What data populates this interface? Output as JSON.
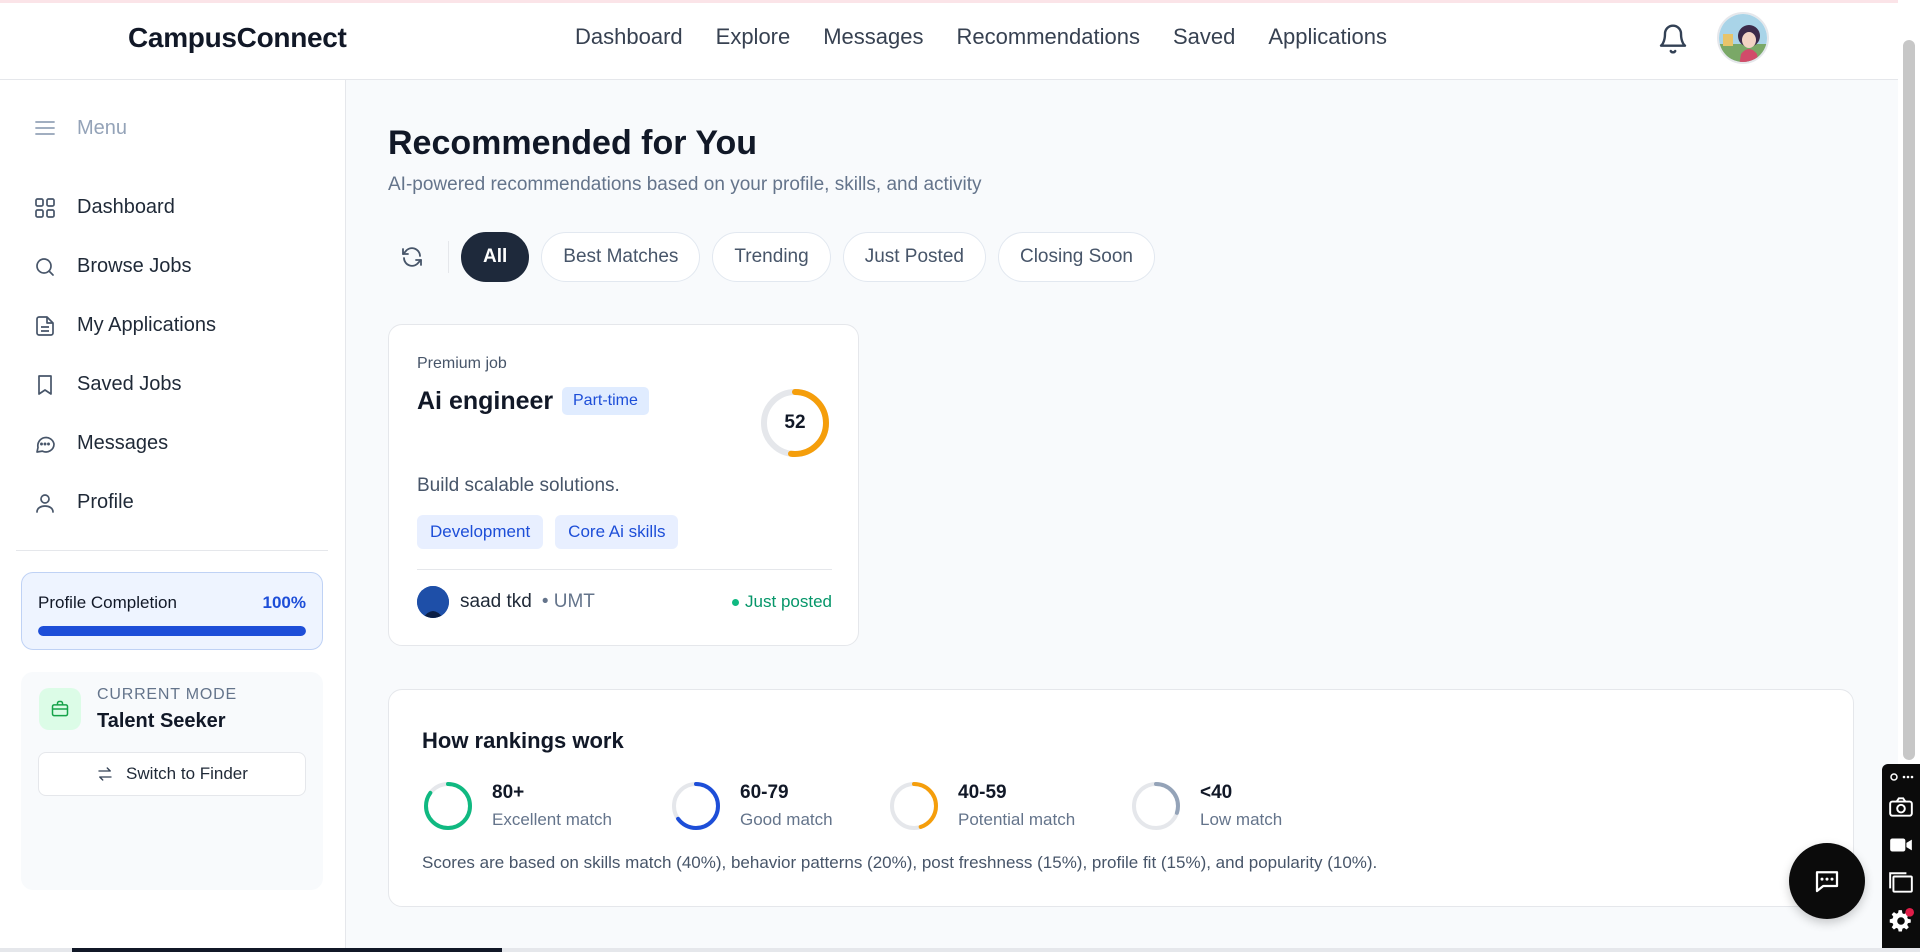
{
  "app": {
    "brand": "CampusConnect"
  },
  "nav": {
    "links": [
      "Dashboard",
      "Explore",
      "Messages",
      "Recommendations",
      "Saved",
      "Applications"
    ]
  },
  "header_icons": {
    "notifications": "bell-icon",
    "avatar": "user-avatar"
  },
  "sidebar": {
    "menu_label": "Menu",
    "items": [
      {
        "label": "Dashboard",
        "icon": "grid-icon"
      },
      {
        "label": "Browse Jobs",
        "icon": "search-icon"
      },
      {
        "label": "My Applications",
        "icon": "document-icon"
      },
      {
        "label": "Saved Jobs",
        "icon": "bookmark-icon"
      },
      {
        "label": "Messages",
        "icon": "chat-icon"
      },
      {
        "label": "Profile",
        "icon": "user-icon"
      }
    ],
    "profile_completion": {
      "label": "Profile Completion",
      "value": "100%",
      "fraction": 1.0
    },
    "mode": {
      "small_label": "CURRENT MODE",
      "name": "Talent Seeker",
      "switch_label": "Switch to Finder"
    }
  },
  "main": {
    "title": "Recommended for You",
    "subtitle": "AI-powered recommendations based on your profile, skills, and activity",
    "filters": [
      "All",
      "Best Matches",
      "Trending",
      "Just Posted",
      "Closing Soon"
    ],
    "active_filter": "All",
    "job": {
      "premium_label": "Premium job",
      "title": "Ai engineer",
      "type": "Part-time",
      "score": "52",
      "score_fraction": 0.52,
      "description": "Build scalable solutions.",
      "tags": [
        "Development",
        "Core Ai skills"
      ],
      "poster": "saad tkd",
      "org": "• UMT",
      "status": "Just posted"
    },
    "rankings": {
      "title": "How rankings work",
      "tiers": [
        {
          "range": "80+",
          "label": "Excellent match",
          "color": "#10b981",
          "fraction": 0.85
        },
        {
          "range": "60-79",
          "label": "Good match",
          "color": "#1d4ed8",
          "fraction": 0.65
        },
        {
          "range": "40-59",
          "label": "Potential match",
          "color": "#f59e0b",
          "fraction": 0.45
        },
        {
          "range": "<40",
          "label": "Low match",
          "color": "#94a3b8",
          "fraction": 0.3
        }
      ],
      "note": "Scores are based on skills match (40%), behavior patterns (20%), post freshness (15%), profile fit (15%), and popularity (10%)."
    }
  },
  "colors": {
    "accent": "#1d4ed8",
    "dark": "#1e293b",
    "score_ring": "#f59e0b",
    "success": "#059669"
  }
}
